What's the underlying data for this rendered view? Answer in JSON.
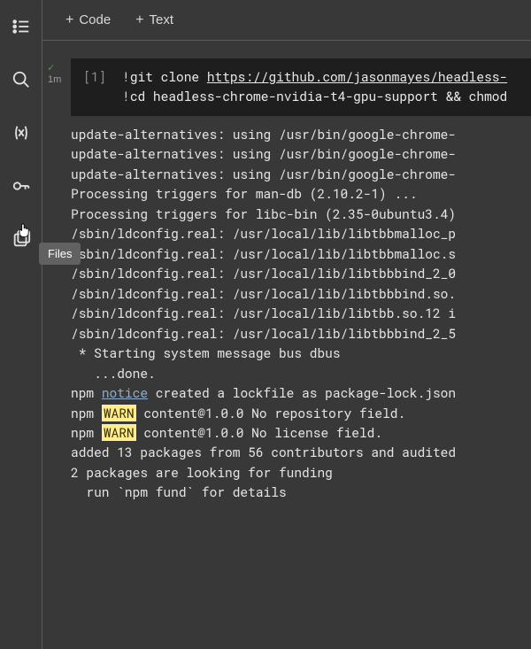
{
  "sidebar": {
    "icons": [
      "toc-icon",
      "search-icon",
      "variables-icon",
      "secrets-icon",
      "files-icon"
    ],
    "tooltip": "Files"
  },
  "toolbar": {
    "code_label": "Code",
    "text_label": "Text"
  },
  "cell": {
    "status_time": "1m",
    "prompt_number": "[1]",
    "code_line1_prefix": "!",
    "code_line1_cmd": "git clone ",
    "code_line1_url": "https://github.com/jasonmayes/headless-",
    "code_line2_prefix": "!",
    "code_line2_cmd": "cd headless-chrome-nvidia-t4-gpu-support && chmod"
  },
  "output": {
    "lines": [
      "update-alternatives: using /usr/bin/google-chrome-",
      "update-alternatives: using /usr/bin/google-chrome-",
      "update-alternatives: using /usr/bin/google-chrome-",
      "Processing triggers for man-db (2.10.2-1) ...",
      "Processing triggers for libc-bin (2.35-0ubuntu3.4)",
      "/sbin/ldconfig.real: /usr/local/lib/libtbbmalloc_p",
      "",
      "/sbin/ldconfig.real: /usr/local/lib/libtbbmalloc.s",
      "",
      "/sbin/ldconfig.real: /usr/local/lib/libtbbbind_2_0",
      "",
      "/sbin/ldconfig.real: /usr/local/lib/libtbbbind.so.",
      "",
      "/sbin/ldconfig.real: /usr/local/lib/libtbb.so.12 i",
      "",
      "/sbin/ldconfig.real: /usr/local/lib/libtbbbind_2_5",
      "",
      " * Starting system message bus dbus",
      "   ...done."
    ],
    "npm_notice_prefix": "npm ",
    "npm_notice_word": "notice",
    "npm_notice_rest": " created a lockfile as package-lock.json",
    "npm_warn_prefix": "npm ",
    "npm_warn_word": "WARN",
    "npm_warn1_rest": " content@1.0.0 No repository field.",
    "npm_warn2_rest": " content@1.0.0 No license field.",
    "trailing": [
      "",
      "added 13 packages from 56 contributors and audited",
      "",
      "2 packages are looking for funding",
      "  run `npm fund` for details"
    ]
  }
}
